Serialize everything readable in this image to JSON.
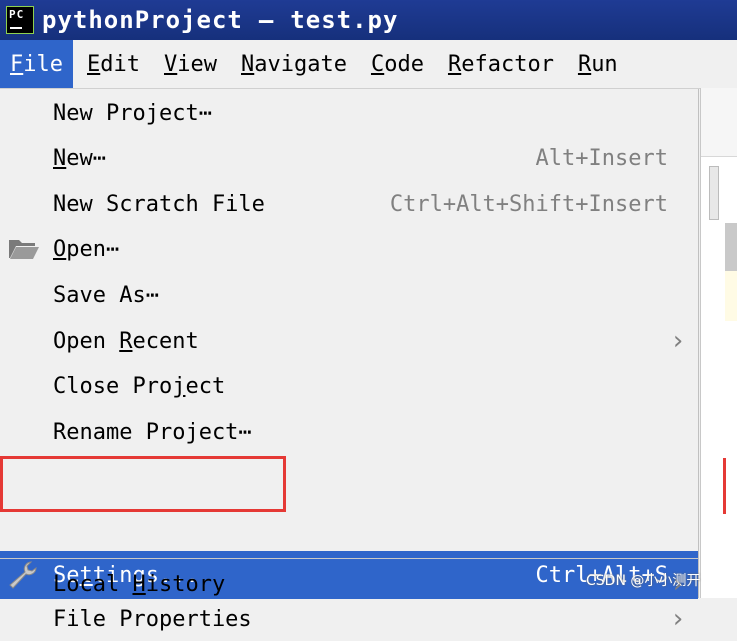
{
  "window": {
    "project": "pythonProject",
    "separator": "—",
    "file": "test.py",
    "icon_text": "PC"
  },
  "menubar": {
    "items": [
      {
        "mnemonic": "F",
        "rest": "ile",
        "active": true
      },
      {
        "mnemonic": "E",
        "rest": "dit"
      },
      {
        "mnemonic": "V",
        "rest": "iew"
      },
      {
        "mnemonic": "N",
        "rest": "avigate"
      },
      {
        "mnemonic": "C",
        "rest": "ode"
      },
      {
        "mnemonic": "R",
        "rest": "efactor"
      },
      {
        "mnemonic": "R",
        "rest": "un"
      }
    ]
  },
  "file_menu": {
    "new_project": {
      "label": "New Project⋯"
    },
    "new": {
      "pre": "",
      "mn": "N",
      "post": "ew⋯",
      "shortcut": "Alt+Insert"
    },
    "new_scratch": {
      "label": "New Scratch File",
      "shortcut": "Ctrl+Alt+Shift+Insert"
    },
    "open": {
      "pre": "",
      "mn": "O",
      "post": "pen⋯",
      "icon": "folder-open-icon"
    },
    "save_as": {
      "label": "Save As⋯"
    },
    "open_recent": {
      "pre": "Open ",
      "mn": "R",
      "post": "ecent",
      "submenu": "›"
    },
    "close_project": {
      "pre": "Close Pro",
      "mn": "j",
      "post": "ect"
    },
    "rename_project": {
      "label": "Rename Project⋯"
    },
    "settings": {
      "pre": "Se",
      "mn": "t",
      "post": "tings...",
      "shortcut": "Ctrl+Alt+S",
      "icon": "wrench-icon"
    },
    "file_properties": {
      "label": "File Properties",
      "submenu": "›"
    },
    "local_history": {
      "pre": "Local ",
      "mn": "H",
      "post": "istory",
      "submenu": "›"
    }
  },
  "colors": {
    "title_bg": "#1f3b94",
    "selection": "#2f65ca",
    "highlight_box": "#e53935"
  },
  "watermark": "CSDN @小小测开"
}
